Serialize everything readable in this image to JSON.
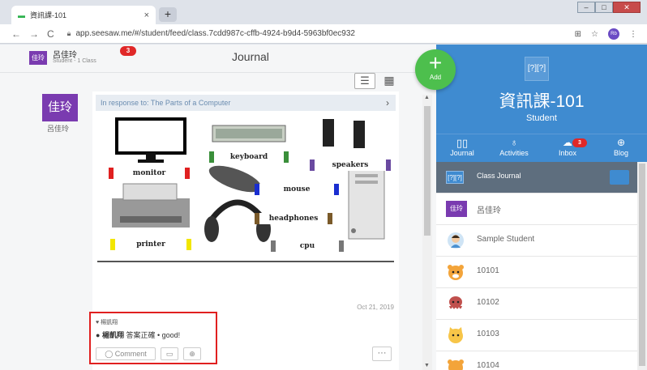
{
  "browser": {
    "tab_title": "資訊課-101",
    "tab_close": "×",
    "new_tab": "+",
    "url": "app.seesaw.me/#/student/feed/class.7cdd987c-cffb-4924-b9d4-5963bf0ec932",
    "profile_initials": "Rb"
  },
  "header": {
    "student_avatar": "佳玲",
    "student_name": "呂佳玲",
    "student_sub": "Student - 1 Class",
    "notif_count": "3",
    "title": "Journal",
    "add_label": "Add"
  },
  "post": {
    "avatar": "佳玲",
    "author": "呂佳玲",
    "response_to": "In response to: The Parts of a Computer",
    "image_labels": [
      "monitor",
      "keyboard",
      "speakers",
      "mouse",
      "headphones",
      "printer",
      "cpu"
    ],
    "date": "Oct 21, 2019",
    "more": "···"
  },
  "comments": {
    "liker": "楊凱翔",
    "commenter": "楊凱翔",
    "comment_text": "答案正確 • good!",
    "comment_button": "Comment"
  },
  "class_panel": {
    "icon_text": "[?][?]",
    "class_name": "資訊課-101",
    "role": "Student",
    "tabs": [
      {
        "label": "Journal",
        "icon": "journal-icon",
        "active": true
      },
      {
        "label": "Activities",
        "icon": "lightbulb-icon",
        "active": false
      },
      {
        "label": "Inbox",
        "icon": "chat-icon",
        "badge": "3",
        "active": false
      },
      {
        "label": "Blog",
        "icon": "globe-icon",
        "active": false
      }
    ],
    "list": [
      {
        "name": "Class Journal",
        "avatar": "[?][?]",
        "selected": true
      },
      {
        "name": "呂佳玲",
        "avatar": "佳玲"
      },
      {
        "name": "Sample Student",
        "avatar": "sample-avatar-icon"
      },
      {
        "name": "10101",
        "avatar": "tiger-icon"
      },
      {
        "name": "10102",
        "avatar": "octopus-icon"
      },
      {
        "name": "10103",
        "avatar": "cat-icon"
      },
      {
        "name": "10104",
        "avatar": "tiger-icon"
      }
    ]
  },
  "colors": {
    "brand_blue": "#3f8bd0",
    "add_green": "#4dbf4d",
    "badge_red": "#e02828",
    "student_purple": "#7a3bb0"
  }
}
